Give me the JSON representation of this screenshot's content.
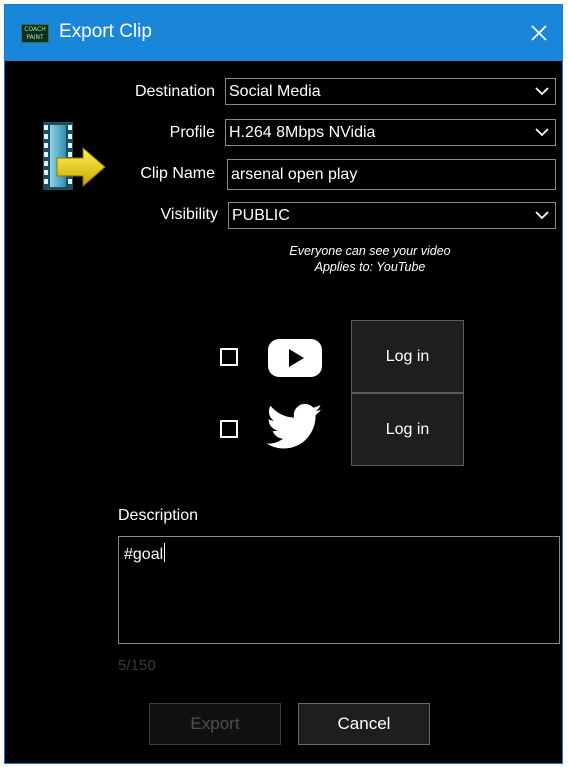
{
  "window": {
    "title": "Export Clip",
    "logo_line1": "COACH",
    "logo_line2": "PAINT"
  },
  "form": {
    "destination": {
      "label": "Destination",
      "value": "Social Media"
    },
    "profile": {
      "label": "Profile",
      "value": "H.264 8Mbps NVidia"
    },
    "clip_name": {
      "label": "Clip Name",
      "value": "arsenal open play"
    },
    "visibility": {
      "label": "Visibility",
      "value": "PUBLIC"
    },
    "visibility_hint_line1": "Everyone can see your video",
    "visibility_hint_line2": "Applies to: YouTube"
  },
  "social": {
    "youtube": {
      "checked": false,
      "login_label": "Log in"
    },
    "twitter": {
      "checked": false,
      "login_label": "Log in"
    }
  },
  "description": {
    "label": "Description",
    "value": "#goal",
    "counter": "5/150"
  },
  "buttons": {
    "export": "Export",
    "cancel": "Cancel"
  },
  "colors": {
    "titlebar": "#1986d9",
    "background": "#000000",
    "arrow": "#e8d800"
  }
}
